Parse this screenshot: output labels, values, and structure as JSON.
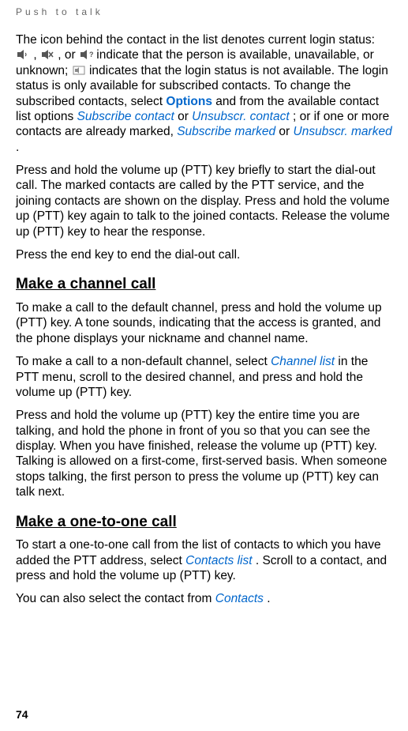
{
  "header": "Push to talk",
  "para1": {
    "t1": "The icon behind the contact in the list denotes current login status: ",
    "t2": ", ",
    "t3": ", or ",
    "t4": " indicate that the person is available, unavailable, or unknown; ",
    "t5": " indicates that the login status is not available. The login status is only available for subscribed contacts. To change the subscribed contacts, select ",
    "options": "Options",
    "t6": " and from the available contact list options ",
    "subscribe_contact": "Subscribe contact",
    "t7": " or ",
    "unsubscr_contact": "Unsubscr. contact",
    "t8": "; or if one or more contacts are already marked, ",
    "subscribe_marked": "Subscribe marked",
    "t9": " or ",
    "unsubscr_marked": "Unsubscr. marked",
    "t10": "."
  },
  "para2": "Press and hold the volume up (PTT) key briefly to start the dial-out call. The marked contacts are called by the PTT service, and the joining contacts are shown on the display. Press and hold the volume up (PTT) key again to talk to the joined contacts. Release the volume up (PTT) key to hear the response.",
  "para3": "Press the end key to end the dial-out call.",
  "heading1": "Make a channel call",
  "para4": "To make a call to the default channel, press and hold the volume up (PTT) key. A tone sounds, indicating that the access is granted, and the phone displays your nickname and channel name.",
  "para5": {
    "t1": "To make a call to a non-default channel, select ",
    "channel_list": "Channel list",
    "t2": " in the PTT menu, scroll to the desired channel, and press and hold the volume up (PTT) key."
  },
  "para6": "Press and hold the volume up (PTT) key the entire time you are talking, and hold the phone in front of you so that you can see the display. When you have finished, release the volume up (PTT) key. Talking is allowed on a first-come, first-served basis. When someone stops talking, the first person to press the volume up (PTT) key can talk next.",
  "heading2": "Make a one-to-one call",
  "para7": {
    "t1": "To start a one-to-one call from the list of contacts to which you have added the PTT address, select ",
    "contacts_list": "Contacts list",
    "t2": ". Scroll to a contact, and press and hold the volume up (PTT) key."
  },
  "para8": {
    "t1": "You can also select the contact from ",
    "contacts": "Contacts",
    "t2": "."
  },
  "page_number": "74"
}
